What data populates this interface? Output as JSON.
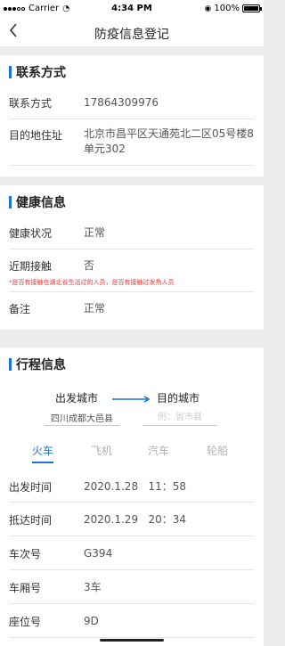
{
  "status_bar": {
    "carrier": "Carrier",
    "time": "4:34 PM",
    "battery": "100%"
  },
  "nav": {
    "title": "防疫信息登记"
  },
  "contact": {
    "section_title": "联系方式",
    "phone_label": "联系方式",
    "phone_value": "17864309976",
    "address_label": "目的地住址",
    "address_value": "北京市昌平区天通苑北二区05号楼8单元302"
  },
  "health": {
    "section_title": "健康信息",
    "status_label": "健康状况",
    "status_value": "正常",
    "contact_label": "近期接触",
    "contact_value": "否",
    "contact_hint": "*是否有接触在湖北省生活过的人员，是否有接触过发热人员",
    "note_label": "备注",
    "note_value": "正常"
  },
  "trip": {
    "section_title": "行程信息",
    "from_label": "出发城市",
    "to_label": "目的城市",
    "from_value": "四川成都大邑县",
    "to_placeholder": "例：省市县",
    "tabs": [
      "火车",
      "飞机",
      "汽车",
      "轮船"
    ],
    "active_tab_index": 0,
    "depart_label": "出发时间",
    "depart_value": "2020.1.28   11：58",
    "arrive_label": "抵达时间",
    "arrive_value": "2020.1.29   20：34",
    "train_label": "车次号",
    "train_value": "G394",
    "car_label": "车厢号",
    "car_value": "3车",
    "seat_label": "座位号",
    "seat_value": "9D"
  },
  "colors": {
    "accent": "#1a73d9",
    "hint": "#e23b3b",
    "background": "#ececec"
  }
}
